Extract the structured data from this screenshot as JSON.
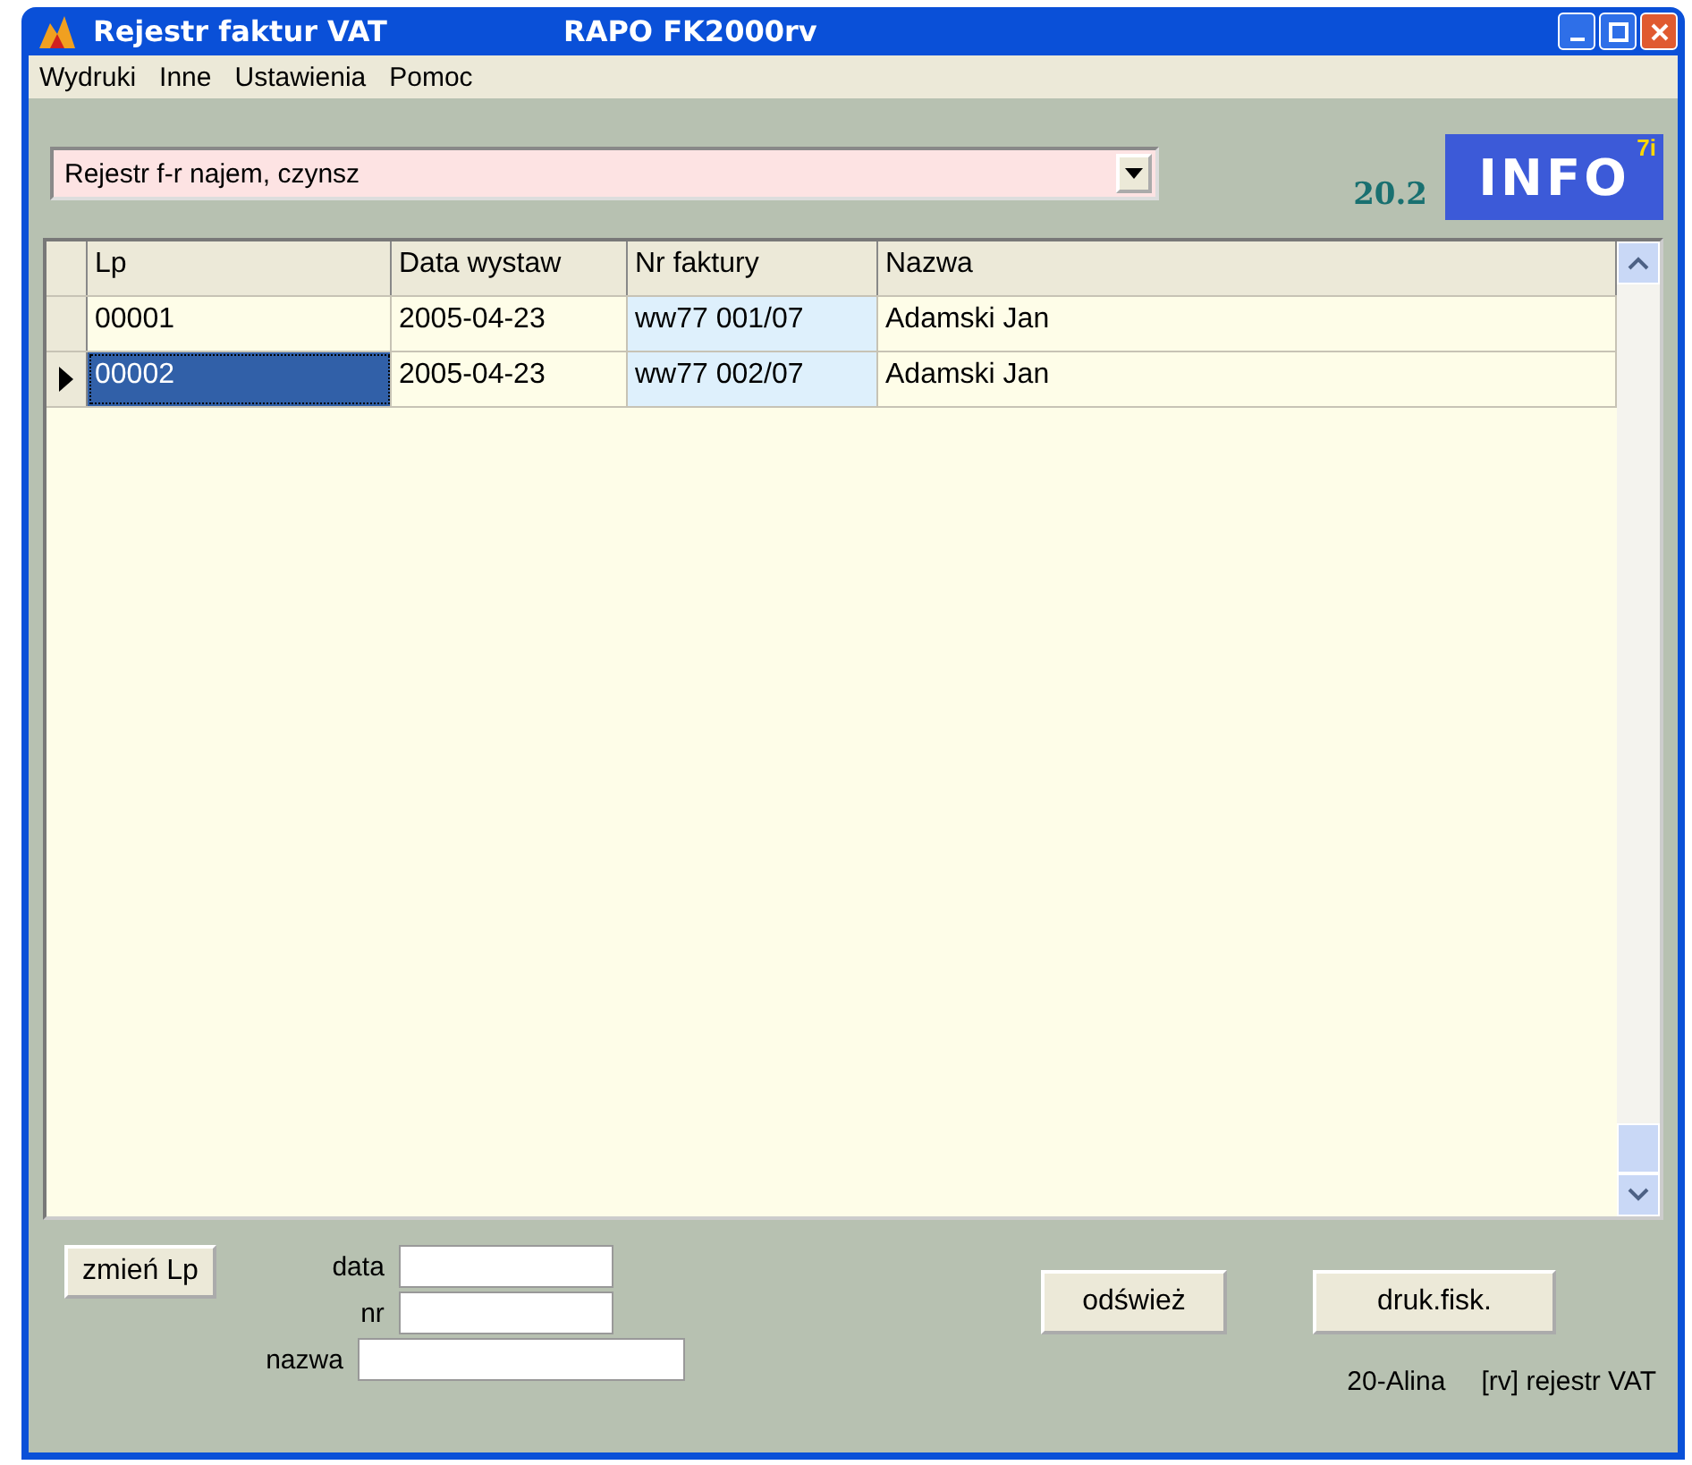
{
  "window": {
    "title": "Rejestr faktur VAT",
    "subtitle": "RAPO  FK2000rv"
  },
  "menu": [
    "Wydruki",
    "Inne",
    "Ustawienia",
    "Pomoc"
  ],
  "register_select": {
    "value": "Rejestr f-r najem, czynsz"
  },
  "version": "20.2",
  "logo": {
    "text": "INFO",
    "badge": "7i"
  },
  "table": {
    "columns": [
      "Lp",
      "Data wystaw",
      "Nr faktury",
      "Nazwa"
    ],
    "rows": [
      {
        "cells": [
          "00001",
          "2005-04-23",
          "ww77 001/07",
          "Adamski Jan"
        ],
        "selected": false
      },
      {
        "cells": [
          "00002",
          "2005-04-23",
          "ww77 002/07",
          "Adamski Jan"
        ],
        "selected": true
      }
    ]
  },
  "change_lp_button": "zmień Lp",
  "filters": [
    {
      "label": "data"
    },
    {
      "label": "nr"
    },
    {
      "label": "nazwa"
    }
  ],
  "buttons": [
    "odśwież",
    "druk.fisk."
  ],
  "status": [
    "20-Alina",
    "[rv] rejestr VAT"
  ]
}
